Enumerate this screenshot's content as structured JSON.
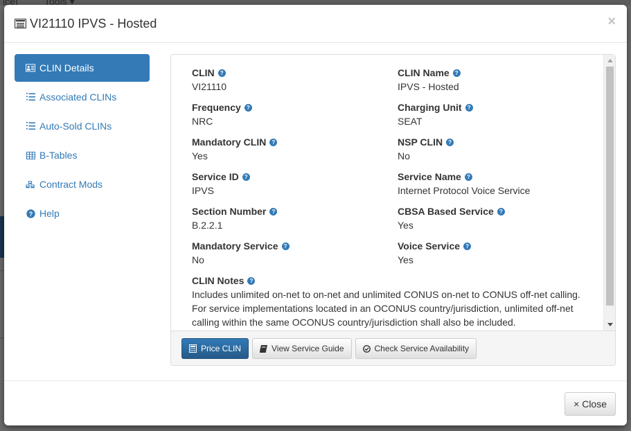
{
  "background": {
    "nav_text_left": "ice]",
    "nav_text_tools": "Tools ▾"
  },
  "modal": {
    "title": "VI21110 IPVS - Hosted",
    "close_symbol": "×"
  },
  "sidebar": {
    "items": [
      {
        "label": "CLIN Details",
        "icon": "id-card-icon",
        "active": true
      },
      {
        "label": "Associated CLINs",
        "icon": "ordered-list-icon",
        "active": false
      },
      {
        "label": "Auto-Sold CLINs",
        "icon": "ordered-list-icon",
        "active": false
      },
      {
        "label": "B-Tables",
        "icon": "table-icon",
        "active": false
      },
      {
        "label": "Contract Mods",
        "icon": "cubes-icon",
        "active": false
      },
      {
        "label": "Help",
        "icon": "question-circle-icon",
        "active": false
      }
    ]
  },
  "details": {
    "fields": [
      {
        "label": "CLIN",
        "value": "VI21110"
      },
      {
        "label": "CLIN Name",
        "value": "IPVS - Hosted"
      },
      {
        "label": "Frequency",
        "value": "NRC"
      },
      {
        "label": "Charging Unit",
        "value": "SEAT"
      },
      {
        "label": "Mandatory CLIN",
        "value": "Yes"
      },
      {
        "label": "NSP CLIN",
        "value": "No"
      },
      {
        "label": "Service ID",
        "value": "IPVS"
      },
      {
        "label": "Service Name",
        "value": "Internet Protocol Voice Service"
      },
      {
        "label": "Section Number",
        "value": "B.2.2.1"
      },
      {
        "label": "CBSA Based Service",
        "value": "Yes"
      },
      {
        "label": "Mandatory Service",
        "value": "No"
      },
      {
        "label": "Voice Service",
        "value": "Yes"
      }
    ],
    "notes": {
      "label": "CLIN Notes",
      "value": "Includes unlimited on-net to on-net and unlimited CONUS on-net to CONUS off-net calling. For service implementations located in an OCONUS country/jurisdiction, unlimited off-net calling within the same OCONUS country/jurisdiction shall also be included."
    },
    "help_symbol": "?"
  },
  "actions": {
    "price_clin": "Price CLIN",
    "view_service_guide": "View Service Guide",
    "check_service_availability": "Check Service Availability"
  },
  "footer": {
    "close_label": "× Close"
  },
  "colors": {
    "primary": "#337ab7",
    "text": "#333333",
    "border": "#dddddd"
  }
}
